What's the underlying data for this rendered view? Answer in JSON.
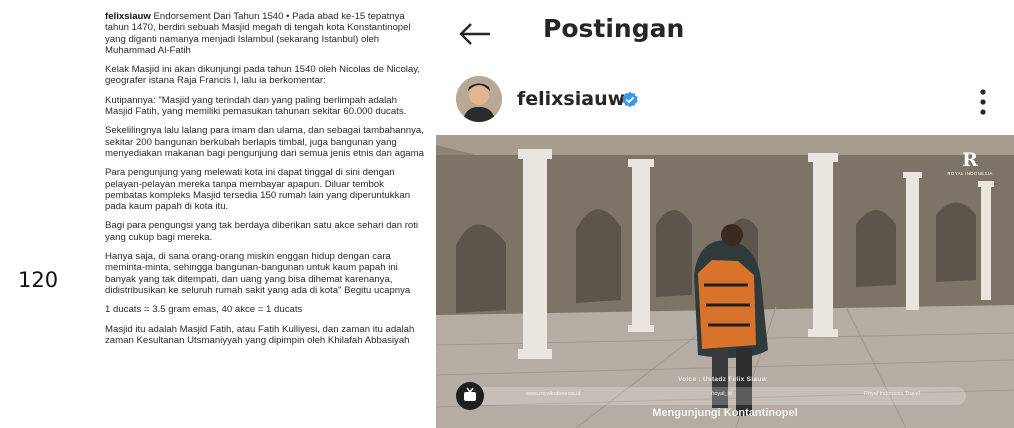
{
  "page_number": "120",
  "caption": {
    "username": "felixsiauw",
    "paragraphs": [
      " Endorsement Dari Tahun 1540 • Pada abad ke-15 tepatnya tahun 1470, berdiri sebuah Masjid megah di tengah kota Konstantinopel yang diganti namanya menjadi Islambul (sekarang Istanbul) oleh Muhammad Al-Fatih",
      "Kelak Masjid ini akan dikunjungi pada tahun 1540 oleh Nicolas de Nicolay, geografer istana Raja Francis I, lalu ia berkomentar:",
      "Kutipannya: \"Masjid yang terindah dan yang paling berlimpah adalah Masjid Fatih, yang memiliki pemasukan tahunan sekitar 60.000 ducats.",
      "Sekelilingnya lalu lalang para imam dan ulama, dan sebagai tambahannya, sekitar 200 bangunan berkubah berlapis timbal, juga bangunan yang menyediakan makanan bagi pengunjung dari semua jenis etnis dan agama",
      "Para pengunjung yang melewati kota ini dapat tinggal di sini dengan pelayan-pelayan mereka tanpa membayar apapun. Diluar tembok pembatas kompleks Masjid tersedia 150 rumah lain yang diperuntukkan pada kaum papah di kota itu.",
      "Bagi para pengungsi yang tak berdaya diberikan satu akce sehari dan roti yang cukup bagi mereka.",
      "Hanya saja, di sana orang-orang miskin enggan hidup dengan cara meminta-minta, sehingga bangunan-bangunan untuk kaum papah ini banyak yang tak ditempati, dan uang yang bisa dihemat karenanya, didistribusikan ke seluruh rumah sakit yang ada di kota\" Begitu ucapnya",
      "1 ducats = 3.5 gram emas, 40 akce = 1 ducats",
      "Masjid itu adalah Masjid Fatih, atau Fatih Kulliyesi, dan zaman itu adalah zaman Kesultanan Utsmaniyyah yang dipimpin oleh Khilafah Abbasiyah"
    ]
  },
  "header": {
    "title": "Postingan"
  },
  "post": {
    "username": "felixsiauw",
    "video": {
      "voice_credit": "Voice : Ustadz Felix Siauw",
      "title": "Mengunjungi Kontantinopel",
      "link_left": "www.royalindonesia.id",
      "social_mid": "/royal_id",
      "social_right": "Royal Indonesia Travel",
      "logo_letter": "R",
      "logo_text": "ROYAL INDONESIA"
    }
  },
  "icons": {
    "back": "arrow-left-icon",
    "verified": "verified-badge-icon",
    "more": "more-vertical-icon",
    "tv": "tv-icon"
  },
  "colors": {
    "verified": "#3897f0",
    "text": "#262626"
  }
}
